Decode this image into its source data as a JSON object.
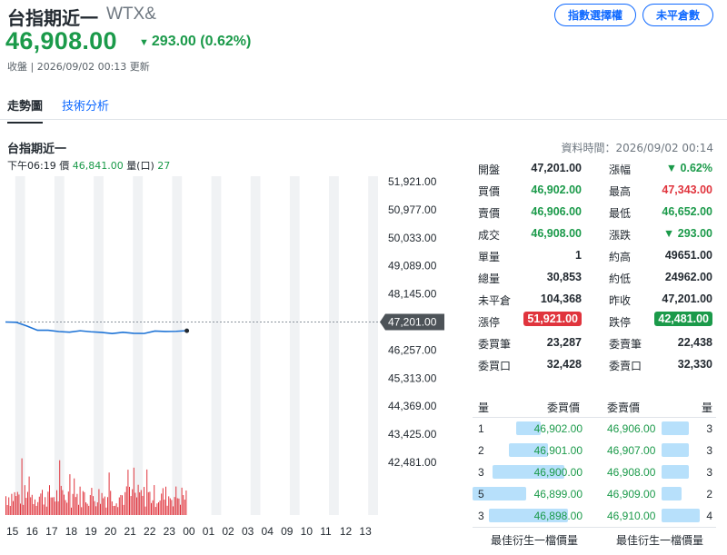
{
  "header": {
    "title": "台指期近一",
    "symbol": "WTX&",
    "price": "46,908.00",
    "change": "293.00 (0.62%)",
    "status": "收盤 | 2026/09/02 00:13 更新",
    "buttons": [
      "指數選擇權",
      "未平倉數"
    ]
  },
  "tabs": [
    "走勢圖",
    "技術分析"
  ],
  "chart_panel": {
    "title": "台指期近一",
    "data_time": "資料時間：2026/09/02 00:14",
    "tick_time": "下午06:19",
    "tick_price_label": "價",
    "tick_price": "46,841.00",
    "tick_vol_label": "量(口)",
    "tick_vol": "27"
  },
  "chart_data": {
    "type": "line",
    "y_ticks": [
      "51,921.00",
      "50,977.00",
      "50,033.00",
      "49,089.00",
      "48,145.00",
      "47,201.00",
      "46,257.00",
      "45,313.00",
      "44,369.00",
      "43,425.00",
      "42,481.00"
    ],
    "ylim": [
      42481,
      51921
    ],
    "reference_price": 47201,
    "reference_label": "47,201.00",
    "x_ticks": [
      "15",
      "16",
      "17",
      "18",
      "19",
      "20",
      "21",
      "22",
      "23",
      "00",
      "01",
      "02",
      "03",
      "04",
      "09",
      "10",
      "11",
      "12",
      "13"
    ],
    "series": [
      {
        "values": [
          47201,
          47180,
          47080,
          46960,
          46900,
          46880,
          46885,
          46870,
          46860,
          46865,
          46850,
          46830,
          46820,
          46840,
          46860,
          46870,
          46900,
          46908
        ]
      }
    ],
    "colors": {
      "line": "#1f74d6",
      "volume": "#e0343d",
      "reference_tag": "#4d5358"
    }
  },
  "quote": {
    "rows": [
      {
        "l1": "開盤",
        "v1": "47,201.00",
        "c1": "",
        "l2": "漲幅",
        "v2": "▼ 0.62%",
        "c2": "green"
      },
      {
        "l1": "買價",
        "v1": "46,902.00",
        "c1": "green",
        "l2": "最高",
        "v2": "47,343.00",
        "c2": "red"
      },
      {
        "l1": "賣價",
        "v1": "46,906.00",
        "c1": "green",
        "l2": "最低",
        "v2": "46,652.00",
        "c2": "green"
      },
      {
        "l1": "成交",
        "v1": "46,908.00",
        "c1": "green",
        "l2": "漲跌",
        "v2": "▼ 293.00",
        "c2": "green"
      },
      {
        "l1": "單量",
        "v1": "1",
        "c1": "",
        "l2": "約高",
        "v2": "49651.00",
        "c2": ""
      },
      {
        "l1": "總量",
        "v1": "30,853",
        "c1": "",
        "l2": "約低",
        "v2": "24962.00",
        "c2": ""
      },
      {
        "l1": "未平倉",
        "v1": "104,368",
        "c1": "",
        "l2": "昨收",
        "v2": "47,201.00",
        "c2": ""
      },
      {
        "l1": "漲停",
        "v1": "51,921.00",
        "c1": "badge-red",
        "l2": "跌停",
        "v2": "42,481.00",
        "c2": "badge-green"
      },
      {
        "l1": "委買筆",
        "v1": "23,287",
        "c1": "",
        "l2": "委賣筆",
        "v2": "22,438",
        "c2": ""
      },
      {
        "l1": "委買口",
        "v1": "32,428",
        "c1": "",
        "l2": "委賣口",
        "v2": "32,330",
        "c2": ""
      }
    ]
  },
  "order_book": {
    "head": [
      "量",
      "委買價",
      "委賣價",
      "量"
    ],
    "rows": [
      {
        "bid_qty": "1",
        "bid": "46,902.00",
        "ask": "46,906.00",
        "ask_qty": "3"
      },
      {
        "bid_qty": "2",
        "bid": "46,901.00",
        "ask": "46,907.00",
        "ask_qty": "3"
      },
      {
        "bid_qty": "3",
        "bid": "46,900.00",
        "ask": "46,908.00",
        "ask_qty": "3"
      },
      {
        "bid_qty": "5",
        "bid": "46,899.00",
        "ask": "46,909.00",
        "ask_qty": "2"
      },
      {
        "bid_qty": "3",
        "bid": "46,898.00",
        "ask": "46,910.00",
        "ask_qty": "4"
      }
    ],
    "foot_left": "最佳衍生一檔價量",
    "foot_right": "最佳衍生一檔價量"
  }
}
